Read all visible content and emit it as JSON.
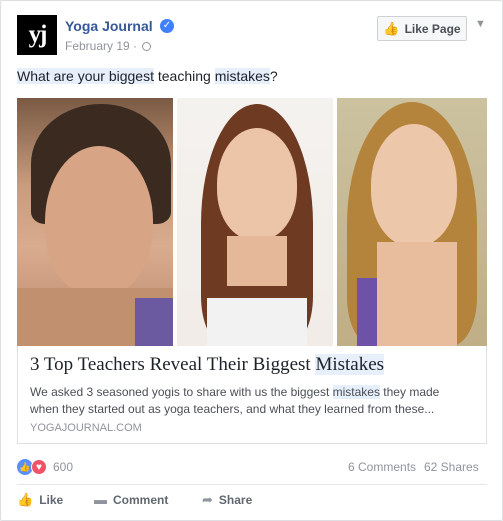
{
  "post": {
    "page_name": "Yoga Journal",
    "avatar_text": "yj",
    "date": "February 19",
    "separator": "·",
    "like_page_label": "Like Page",
    "text_parts": [
      "What are your biggest",
      " teaching ",
      "mistakes",
      "?"
    ]
  },
  "link": {
    "title_main": "3 Top Teachers Reveal Their Biggest ",
    "title_highlight": "Mistakes",
    "desc_before": "We asked 3 seasoned yogis to share with us the biggest ",
    "desc_highlight": "mistakes",
    "desc_after": " they made when they started out as yoga teachers, and what they learned from these...",
    "domain": "YOGAJOURNAL.COM"
  },
  "stats": {
    "reactions_count": "600",
    "comments": "6 Comments",
    "shares": "62 Shares"
  },
  "actions": {
    "like": "Like",
    "comment": "Comment",
    "share": "Share"
  },
  "icons": {
    "verified": "verified-badge-icon",
    "globe": "globe-icon",
    "thumb": "thumbs-up-icon",
    "love": "heart-icon",
    "comment": "comment-bubble-icon",
    "share": "share-arrow-icon"
  },
  "colors": {
    "link_blue": "#365899",
    "highlight_bg": "#e7effb",
    "like_reaction": "#5890ff",
    "love_reaction": "#f25268"
  }
}
